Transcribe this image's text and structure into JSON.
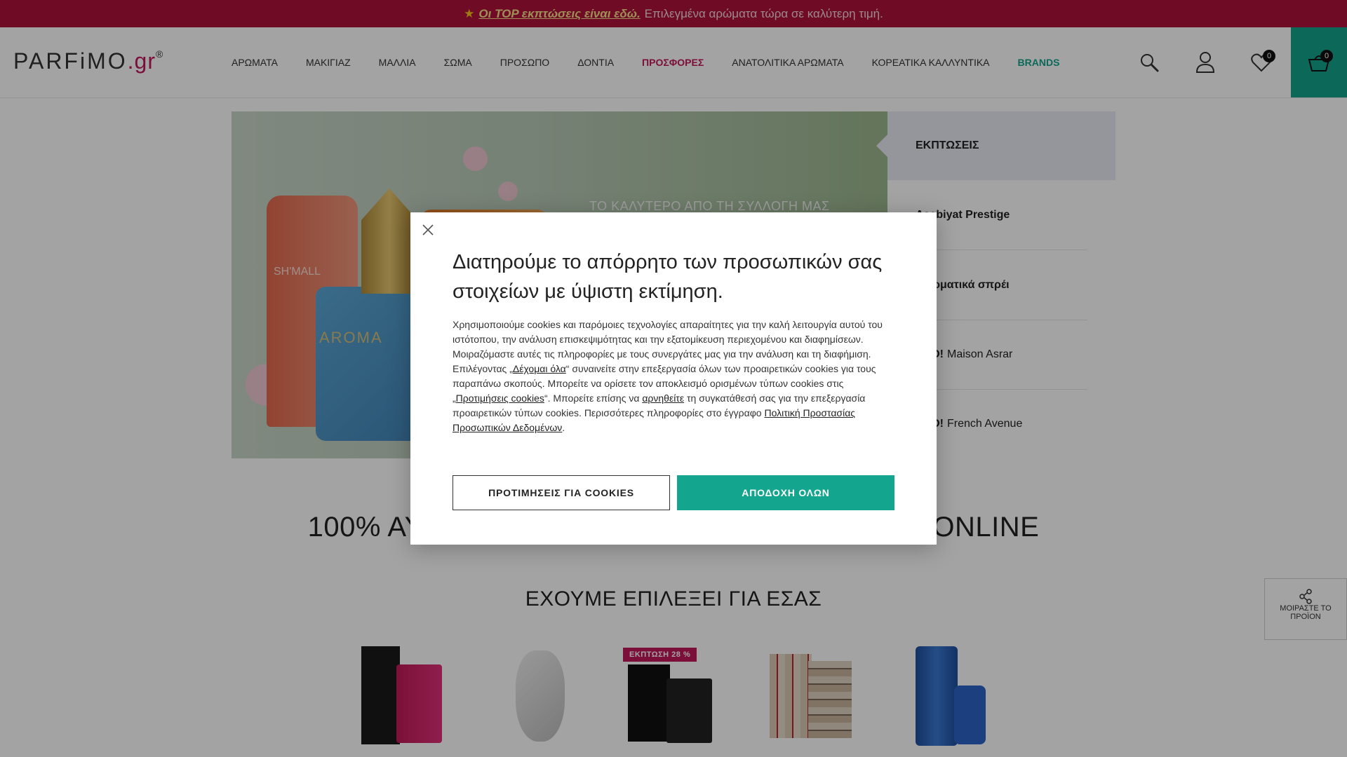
{
  "promo": {
    "link_text": "Οι TOP εκπτώσεις είναι εδώ.",
    "text": "Επιλεγμένα αρώματα τώρα σε καλύτερη τιμή."
  },
  "header": {
    "logo_main": "PARFiMO",
    "logo_domain": ".gr",
    "logo_reg": "®",
    "nav": [
      {
        "label": "ΑΡΩΜΑΤΑ"
      },
      {
        "label": "ΜΑΚΙΓΙΑΖ"
      },
      {
        "label": "ΜΑΛΛΙΑ"
      },
      {
        "label": "ΣΩΜΑ"
      },
      {
        "label": "ΠΡΟΣΩΠΟ"
      },
      {
        "label": "ΔΟΝΤΙΑ"
      },
      {
        "label": "ΠΡΟΣΦΟΡΕΣ"
      },
      {
        "label": "ΑΝΑΤΟΛΙΤΙΚΑ ΑΡΩΜΑΤΑ"
      },
      {
        "label": "ΚΟΡΕΑΤΙΚΑ ΚΑΛΛΥΝΤΙΚΑ"
      },
      {
        "label": "BRANDS"
      }
    ],
    "wishlist_count": "0",
    "cart_count": "0",
    "icons": [
      "search-icon",
      "user-icon",
      "heart-icon",
      "basket-icon"
    ],
    "colors": {
      "accent": "#13a58e",
      "brand": "#c2185b",
      "promo_bar": "#b0123a"
    }
  },
  "hero": {
    "caption": "ΤΟ ΚΑΛΥΤΕΡΟ ΑΠΟ ΤΗ ΣΥΛΛΟΓΗ ΜΑΣ",
    "bottle_text": "SH'MALL",
    "bottle_text_2": "AROMA",
    "side": {
      "title": "ΕΚΠΤΩΣΕΙΣ",
      "items": [
        {
          "bold": "Asabiyat Prestige",
          "text": ""
        },
        {
          "bold": "Αρωματικά σπρέι",
          "text": ""
        },
        {
          "bold": "NEO!",
          "text": "Maison Asrar"
        },
        {
          "bold": "NEO!",
          "text": "French Avenue"
        }
      ]
    }
  },
  "headline": "100% ΑΥΘΕΝΤΙΚΑ ΑΡΩΜΑΤΑ ΚΑΙ ΚΑΛΛΥΝΤΙΚΑ ONLINE",
  "section_title": "ΕΧΟΥΜΕ ΕΠΙΛΕΞΕΙ ΓΙΑ ΕΣΑΣ",
  "products": {
    "discount_badge": "ΕΚΠΤΩΣΗ 28 %"
  },
  "share": {
    "label": "ΜΟΙΡΑΣΤΕ ΤΟ ΠΡΟΪΟΝ"
  },
  "cookie_modal": {
    "title": "Διατηρούμε το απόρρητο των προσωπικών σας στοιχείων με ύψιστη εκτίμηση.",
    "body_1": "Χρησιμοποιούμε cookies και παρόμοιες τεχνολογίες απαραίτητες για την καλή λειτουργία αυτού του ιστότοπου, την ανάλυση επισκεψιμότητας και την εξατομίκευση περιεχομένου και διαφημίσεων. Μοιραζόμαστε αυτές τις πληροφορίες με τους συνεργάτες μας για την ανάλυση και τη διαφήμιση. Επιλέγοντας „",
    "link_accept_all": "Δέχομαι όλα",
    "body_2": "“ συναινείτε στην επεξεργασία όλων των προαιρετικών cookies για τους παραπάνω σκοπούς. Μπορείτε να ορίσετε τον αποκλεισμό ορισμένων τύπων cookies στις „",
    "link_preferences": "Προτιμήσεις cookies",
    "body_3": "“. Μπορείτε επίσης να ",
    "link_decline": "αρνηθείτε",
    "body_4": " τη συγκατάθεσή σας για την επεξεργασία προαιρετικών τύπων cookies. Περισσότερες πληροφορίες στο έγγραφο ",
    "link_policy": "Πολιτική Προστασίας Προσωπικών Δεδομένων",
    "body_5": ".",
    "btn_preferences": "ΠΡΟΤΙΜΗΣΕΙΣ ΓΙΑ COOKIES",
    "btn_accept": "ΑΠΟΔΟΧΗ ΟΛΩΝ"
  }
}
